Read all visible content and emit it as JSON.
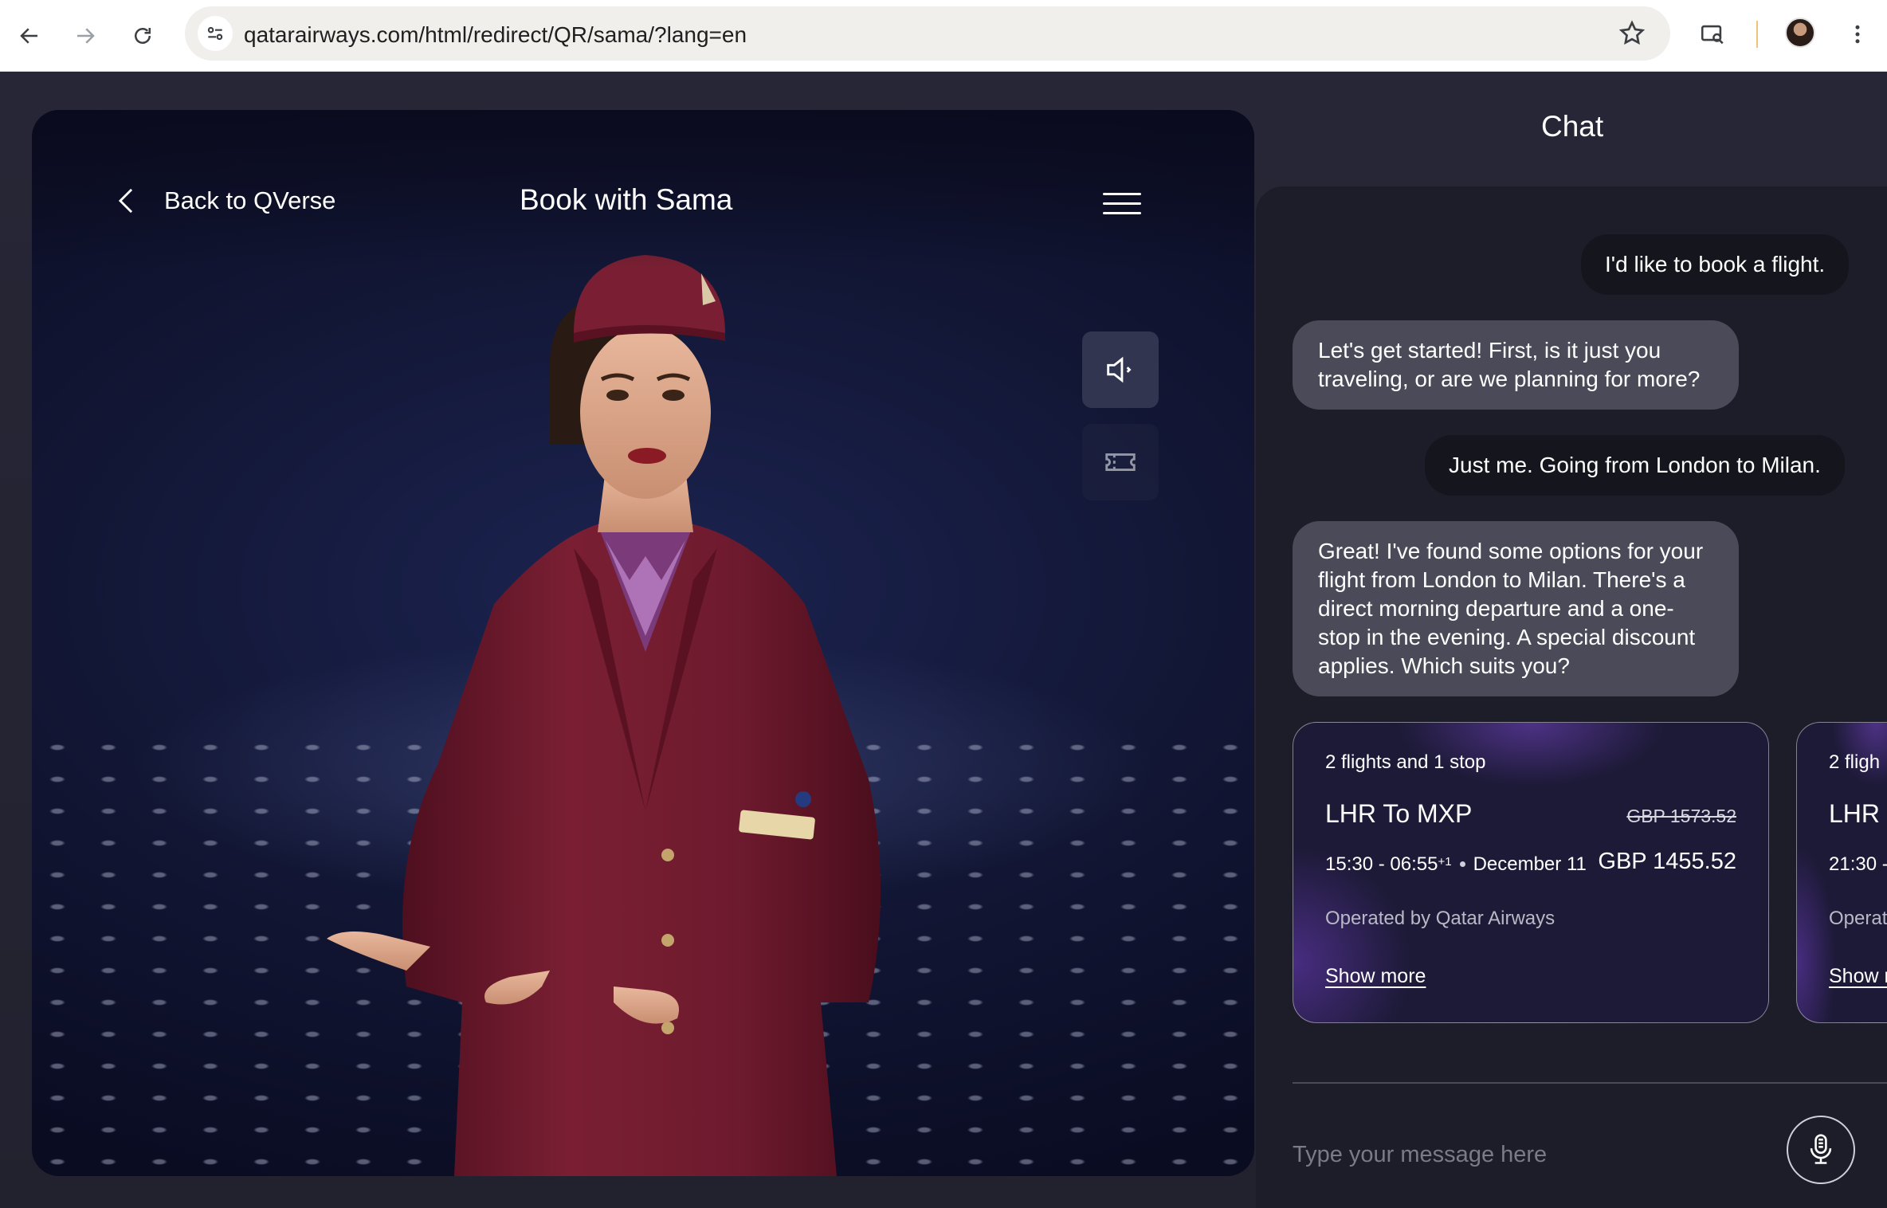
{
  "browser": {
    "url": "qatarairways.com/html/redirect/QR/sama/?lang=en",
    "icons": [
      "back-arrow-icon",
      "forward-arrow-icon",
      "reload-icon",
      "site-info-icon",
      "bookmark-star-icon",
      "cast-search-icon",
      "profile-avatar",
      "more-menu-icon"
    ]
  },
  "stage": {
    "back_label": "Back to QVerse",
    "title": "Book with Sama",
    "icons": [
      "chevron-left-icon",
      "hamburger-menu-icon",
      "speaker-icon",
      "ticket-icon"
    ]
  },
  "chat": {
    "title": "Chat",
    "messages": [
      {
        "from": "user",
        "text": "I'd like to book a flight."
      },
      {
        "from": "bot",
        "text": "Let's get started! First, is it just you traveling, or are we planning for more?"
      },
      {
        "from": "user",
        "text": "Just me. Going from London to Milan."
      },
      {
        "from": "bot",
        "text": "Great! I've found some options for your flight from London to Milan. There's a direct morning departure and a one-stop in the evening. A special discount applies. Which suits you?"
      }
    ],
    "flight_cards": [
      {
        "stops": "2 flights and 1 stop",
        "route": "LHR To MXP",
        "old_price": "GBP 1573.52",
        "times": "15:30 - 06:55",
        "day_offset": "+1",
        "date": "December 11",
        "price": "GBP 1455.52",
        "operator": "Operated by Qatar Airways",
        "show_more": "Show more"
      },
      {
        "stops": "2 fligh",
        "route": "LHR T",
        "times": "21:30 -",
        "operator": "Operat",
        "show_more": "Show m"
      }
    ],
    "input_placeholder": "Type your message here",
    "mic_icon": "microphone-icon"
  },
  "colors": {
    "page_bg": "#22222f",
    "user_bubble": "#15151d",
    "bot_bubble": "#4a4a58",
    "card_bg": "#1d1a37",
    "uniform_burgundy": "#6e1a2e"
  }
}
